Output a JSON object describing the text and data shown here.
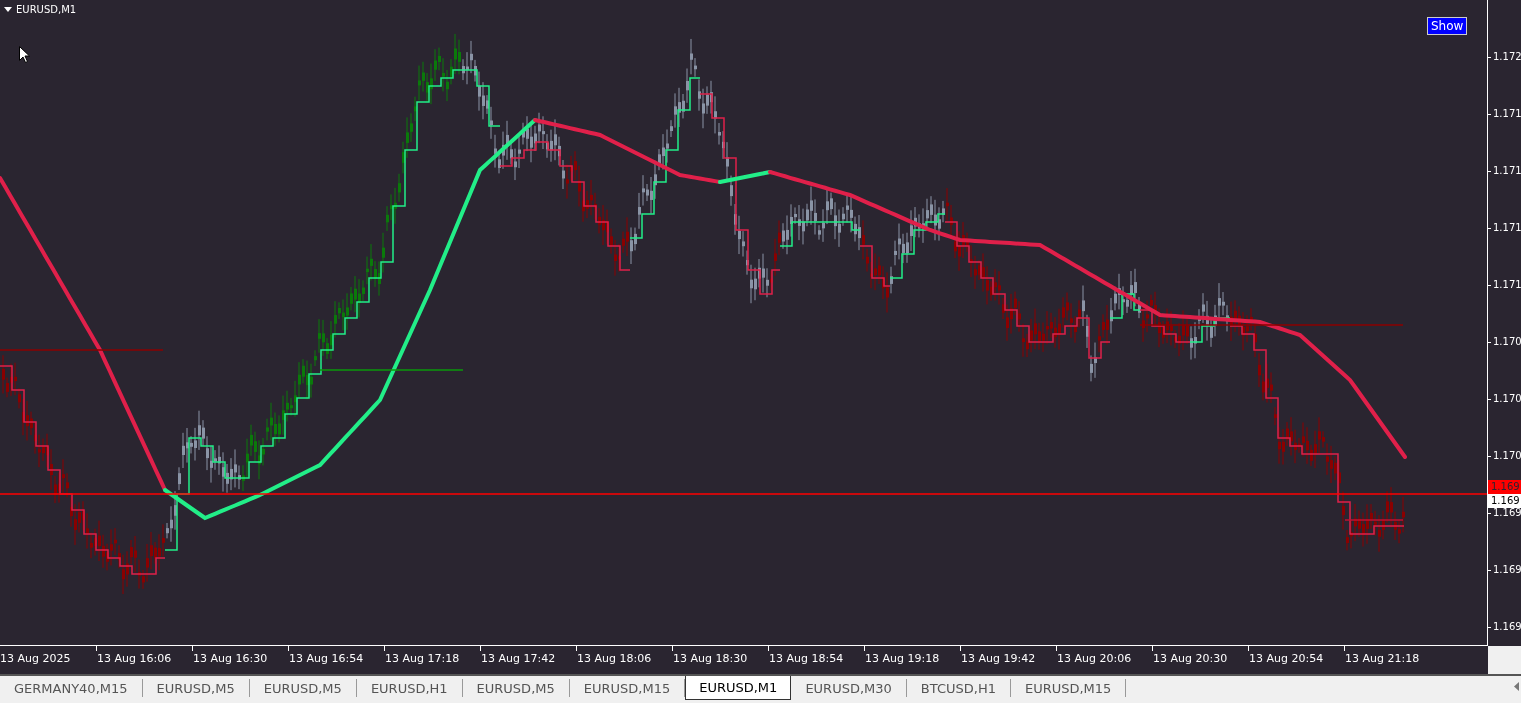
{
  "chart": {
    "title": "EURUSD,M1",
    "button": "Show",
    "price_axis": [
      "1.172",
      "1.171",
      "1.171",
      "1.171",
      "1.171",
      "1.170",
      "1.170",
      "1.170",
      "1.169",
      "1.169",
      "1.169"
    ],
    "bid_label": "1.169",
    "ask_label": "1.169",
    "time_axis": [
      "13 Aug 2025",
      "13 Aug 16:06",
      "13 Aug 16:30",
      "13 Aug 16:54",
      "13 Aug 17:18",
      "13 Aug 17:42",
      "13 Aug 18:06",
      "13 Aug 18:30",
      "13 Aug 18:54",
      "13 Aug 19:18",
      "13 Aug 19:42",
      "13 Aug 20:06",
      "13 Aug 20:30",
      "13 Aug 20:54",
      "13 Aug 21:18"
    ]
  },
  "tabs": [
    {
      "label": "GERMANY40,M15",
      "selected": false
    },
    {
      "label": "EURUSD,M5",
      "selected": false
    },
    {
      "label": "EURUSD,M5",
      "selected": false
    },
    {
      "label": "EURUSD,H1",
      "selected": false
    },
    {
      "label": "EURUSD,M5",
      "selected": false
    },
    {
      "label": "EURUSD,M15",
      "selected": false
    },
    {
      "label": "EURUSD,M1",
      "selected": true
    },
    {
      "label": "EURUSD,M30",
      "selected": false
    },
    {
      "label": "BTCUSD,H1",
      "selected": false
    },
    {
      "label": "EURUSD,M15",
      "selected": false
    }
  ]
}
